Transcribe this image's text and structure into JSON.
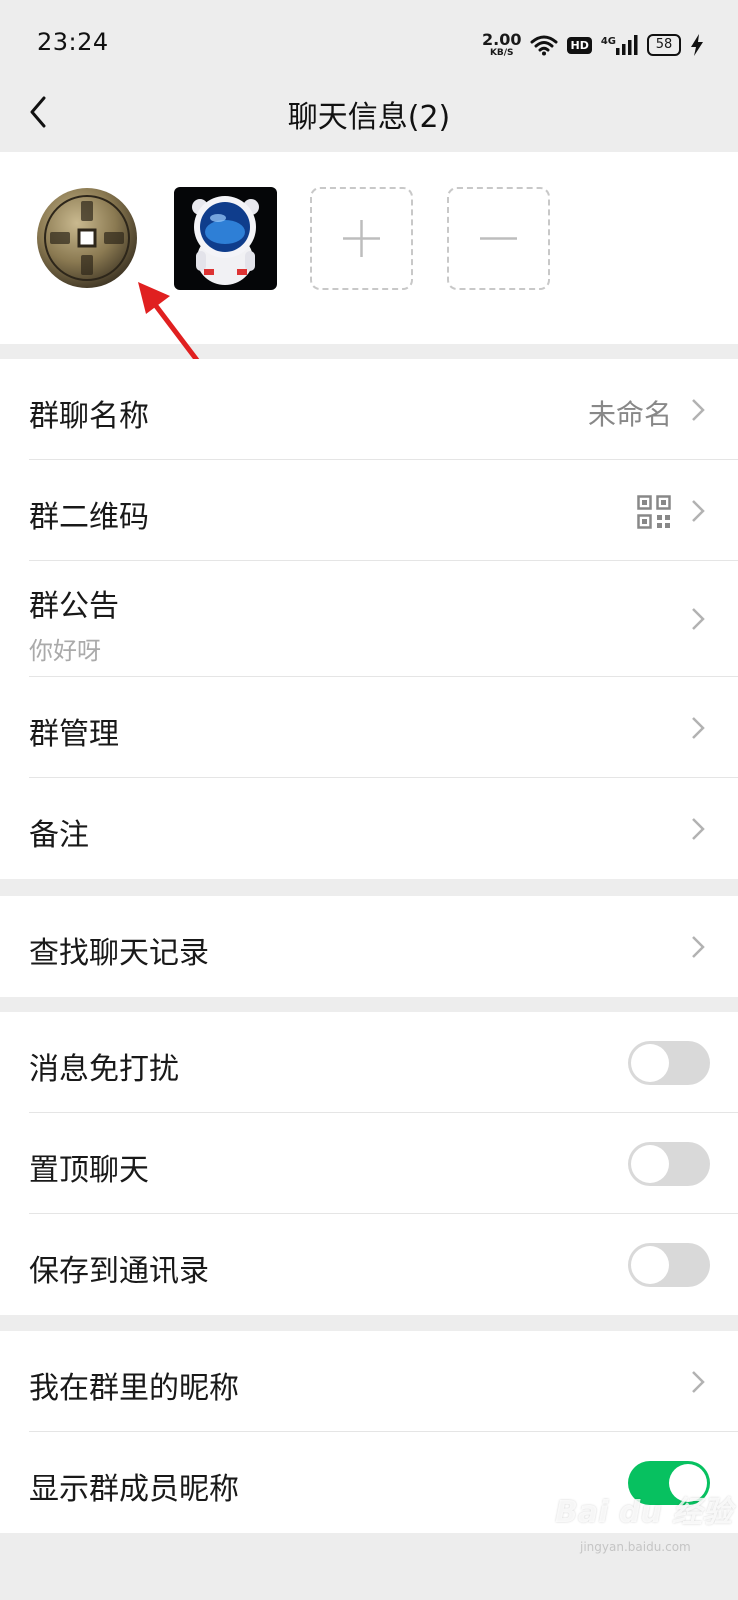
{
  "status_bar": {
    "time": "23:24",
    "speed_value": "2.00",
    "speed_unit": "KB/S",
    "hd_label": "HD",
    "network_label": "4G",
    "battery": "58"
  },
  "header": {
    "title": "聊天信息(2)"
  },
  "members": {
    "add_icon": "plus-icon",
    "remove_icon": "minus-icon"
  },
  "sections": {
    "group_name": {
      "label": "群聊名称",
      "value": "未命名"
    },
    "qr_code": {
      "label": "群二维码"
    },
    "announcement": {
      "label": "群公告",
      "preview": "你好呀"
    },
    "manage": {
      "label": "群管理"
    },
    "remark": {
      "label": "备注"
    },
    "search_history": {
      "label": "查找聊天记录"
    },
    "mute": {
      "label": "消息免打扰",
      "on": false
    },
    "sticky": {
      "label": "置顶聊天",
      "on": false
    },
    "save_contacts": {
      "label": "保存到通讯录",
      "on": false
    },
    "my_nickname": {
      "label": "我在群里的昵称"
    },
    "show_nicknames": {
      "label": "显示群成员昵称",
      "on": true
    }
  },
  "colors": {
    "toggle_on": "#07c160",
    "toggle_off": "#d9d9d9",
    "annotation_arrow": "#e02020"
  },
  "watermark": {
    "brand": "Bai du 经验",
    "url": "jingyan.baidu.com"
  }
}
